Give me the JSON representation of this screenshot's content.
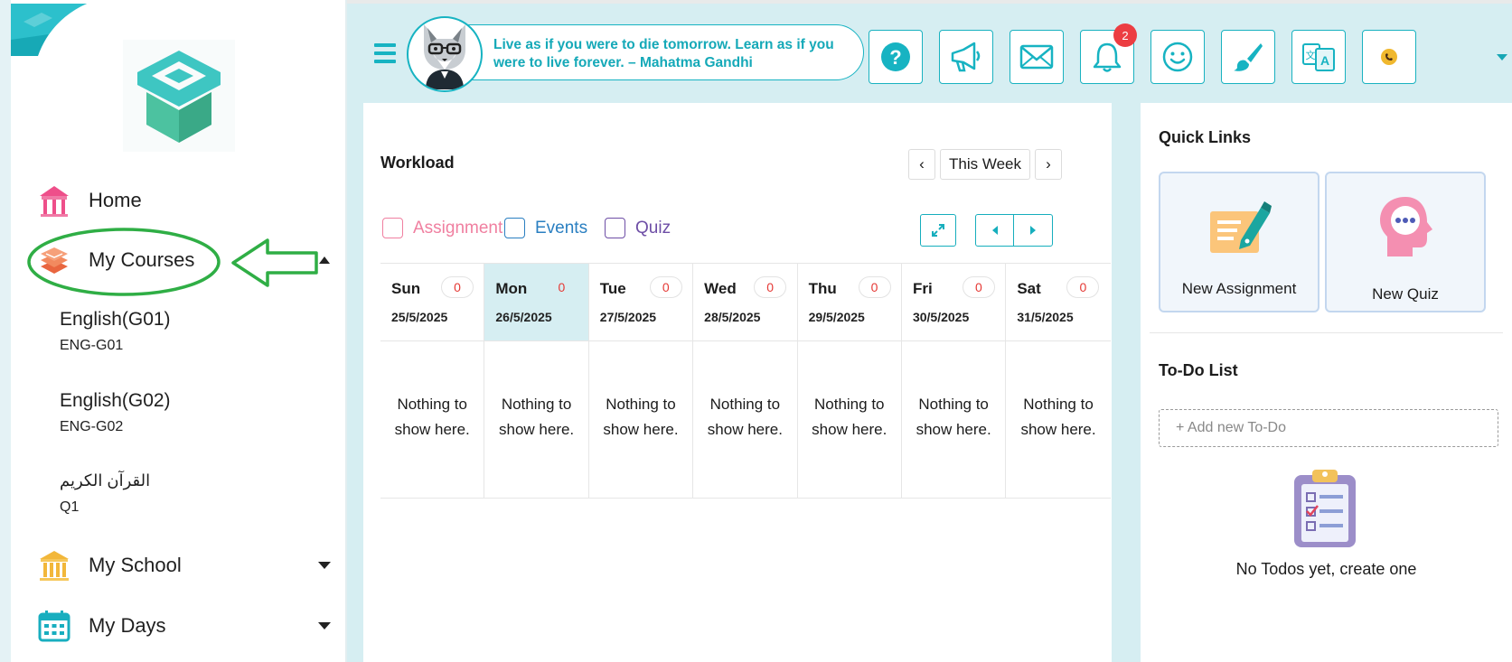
{
  "sidebar": {
    "nav": {
      "home": "Home",
      "my_courses": "My Courses",
      "my_school": "My School",
      "my_days": "My Days"
    },
    "courses": [
      {
        "name": "English(G01)",
        "code": "ENG-G01"
      },
      {
        "name": "English(G02)",
        "code": "ENG-G02"
      },
      {
        "name": "القرآن الكريم",
        "code": "Q1"
      }
    ],
    "annotation_color": "#2fae45"
  },
  "header": {
    "quote": "Live as if you were to die tomorrow. Learn as if you were to live forever. – Mahatma Gandhi",
    "notification_count": "2",
    "icons": [
      "help-icon",
      "announcement-icon",
      "mail-icon",
      "bell-icon",
      "smiley-icon",
      "brush-icon",
      "translate-icon",
      "profile-avatar"
    ],
    "accent_color": "#17b3c2"
  },
  "workload": {
    "title": "Workload",
    "range_label": "This Week",
    "prev_symbol": "‹",
    "next_symbol": "›",
    "legend": [
      {
        "label": "Assignment",
        "color": "#f07fa0"
      },
      {
        "label": "Events",
        "color": "#2a7fc1"
      },
      {
        "label": "Quiz",
        "color": "#6e4ea6"
      }
    ],
    "days": [
      {
        "name": "Sun",
        "date": "25/5/2025",
        "count": "0",
        "empty": "Nothing to show here.",
        "today": false
      },
      {
        "name": "Mon",
        "date": "26/5/2025",
        "count": "0",
        "empty": "Nothing to show here.",
        "today": true
      },
      {
        "name": "Tue",
        "date": "27/5/2025",
        "count": "0",
        "empty": "Nothing to show here.",
        "today": false
      },
      {
        "name": "Wed",
        "date": "28/5/2025",
        "count": "0",
        "empty": "Nothing to show here.",
        "today": false
      },
      {
        "name": "Thu",
        "date": "29/5/2025",
        "count": "0",
        "empty": "Nothing to show here.",
        "today": false
      },
      {
        "name": "Fri",
        "date": "30/5/2025",
        "count": "0",
        "empty": "Nothing to show here.",
        "today": false
      },
      {
        "name": "Sat",
        "date": "31/5/2025",
        "count": "0",
        "empty": "Nothing to show here.",
        "today": false
      }
    ]
  },
  "quick_links": {
    "title": "Quick Links",
    "items": [
      {
        "label": "New Assignment",
        "icon": "new-assignment-icon"
      },
      {
        "label": "New Quiz",
        "icon": "new-quiz-icon"
      }
    ]
  },
  "todo": {
    "title": "To-Do List",
    "placeholder": "+ Add new To-Do",
    "empty_text": "No Todos yet, create one"
  }
}
